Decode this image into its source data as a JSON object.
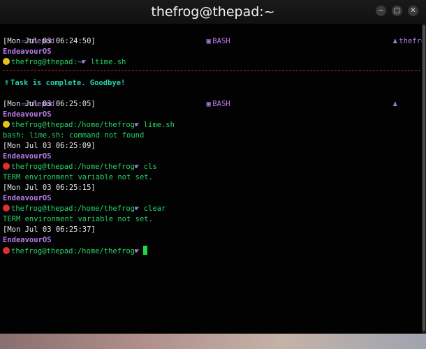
{
  "window": {
    "title": "thefrog@thepad:~"
  },
  "header": {
    "host": "thepad",
    "shell": "BASH",
    "user": "thefrog"
  },
  "block1": {
    "time": "[Mon Jul 03 06:24:50]",
    "os": "EndeavourOS",
    "prompt": "thefrog@thepad:~",
    "command": "ltime.sh"
  },
  "message": "Task is complete. Goodbye!",
  "header2": {
    "host": "thepad",
    "shell": "BASH"
  },
  "block2": {
    "time": "[Mon Jul 03 06:25:05]",
    "os": "EndeavourOS",
    "prompt": "thefrog@thepad:/home/thefrog",
    "command": "lime.sh",
    "output": "bash: lime.sh: command not found"
  },
  "block3": {
    "time": "[Mon Jul 03 06:25:09]",
    "os": "EndeavourOS",
    "prompt": "thefrog@thepad:/home/thefrog",
    "command": "cls",
    "output": "TERM environment variable not set."
  },
  "block4": {
    "time": "[Mon Jul 03 06:25:15]",
    "os": "EndeavourOS",
    "prompt": "thefrog@thepad:/home/thefrog",
    "command": "clear",
    "output": "TERM environment variable not set."
  },
  "block5": {
    "time": "[Mon Jul 03 06:25:37]",
    "os": "EndeavourOS",
    "prompt": "thefrog@thepad:/home/thefrog",
    "command": ""
  },
  "colors": {
    "green": "#25d366",
    "purple": "#b57be8",
    "separator": "#d02020",
    "cursor": "#1ed84a"
  }
}
